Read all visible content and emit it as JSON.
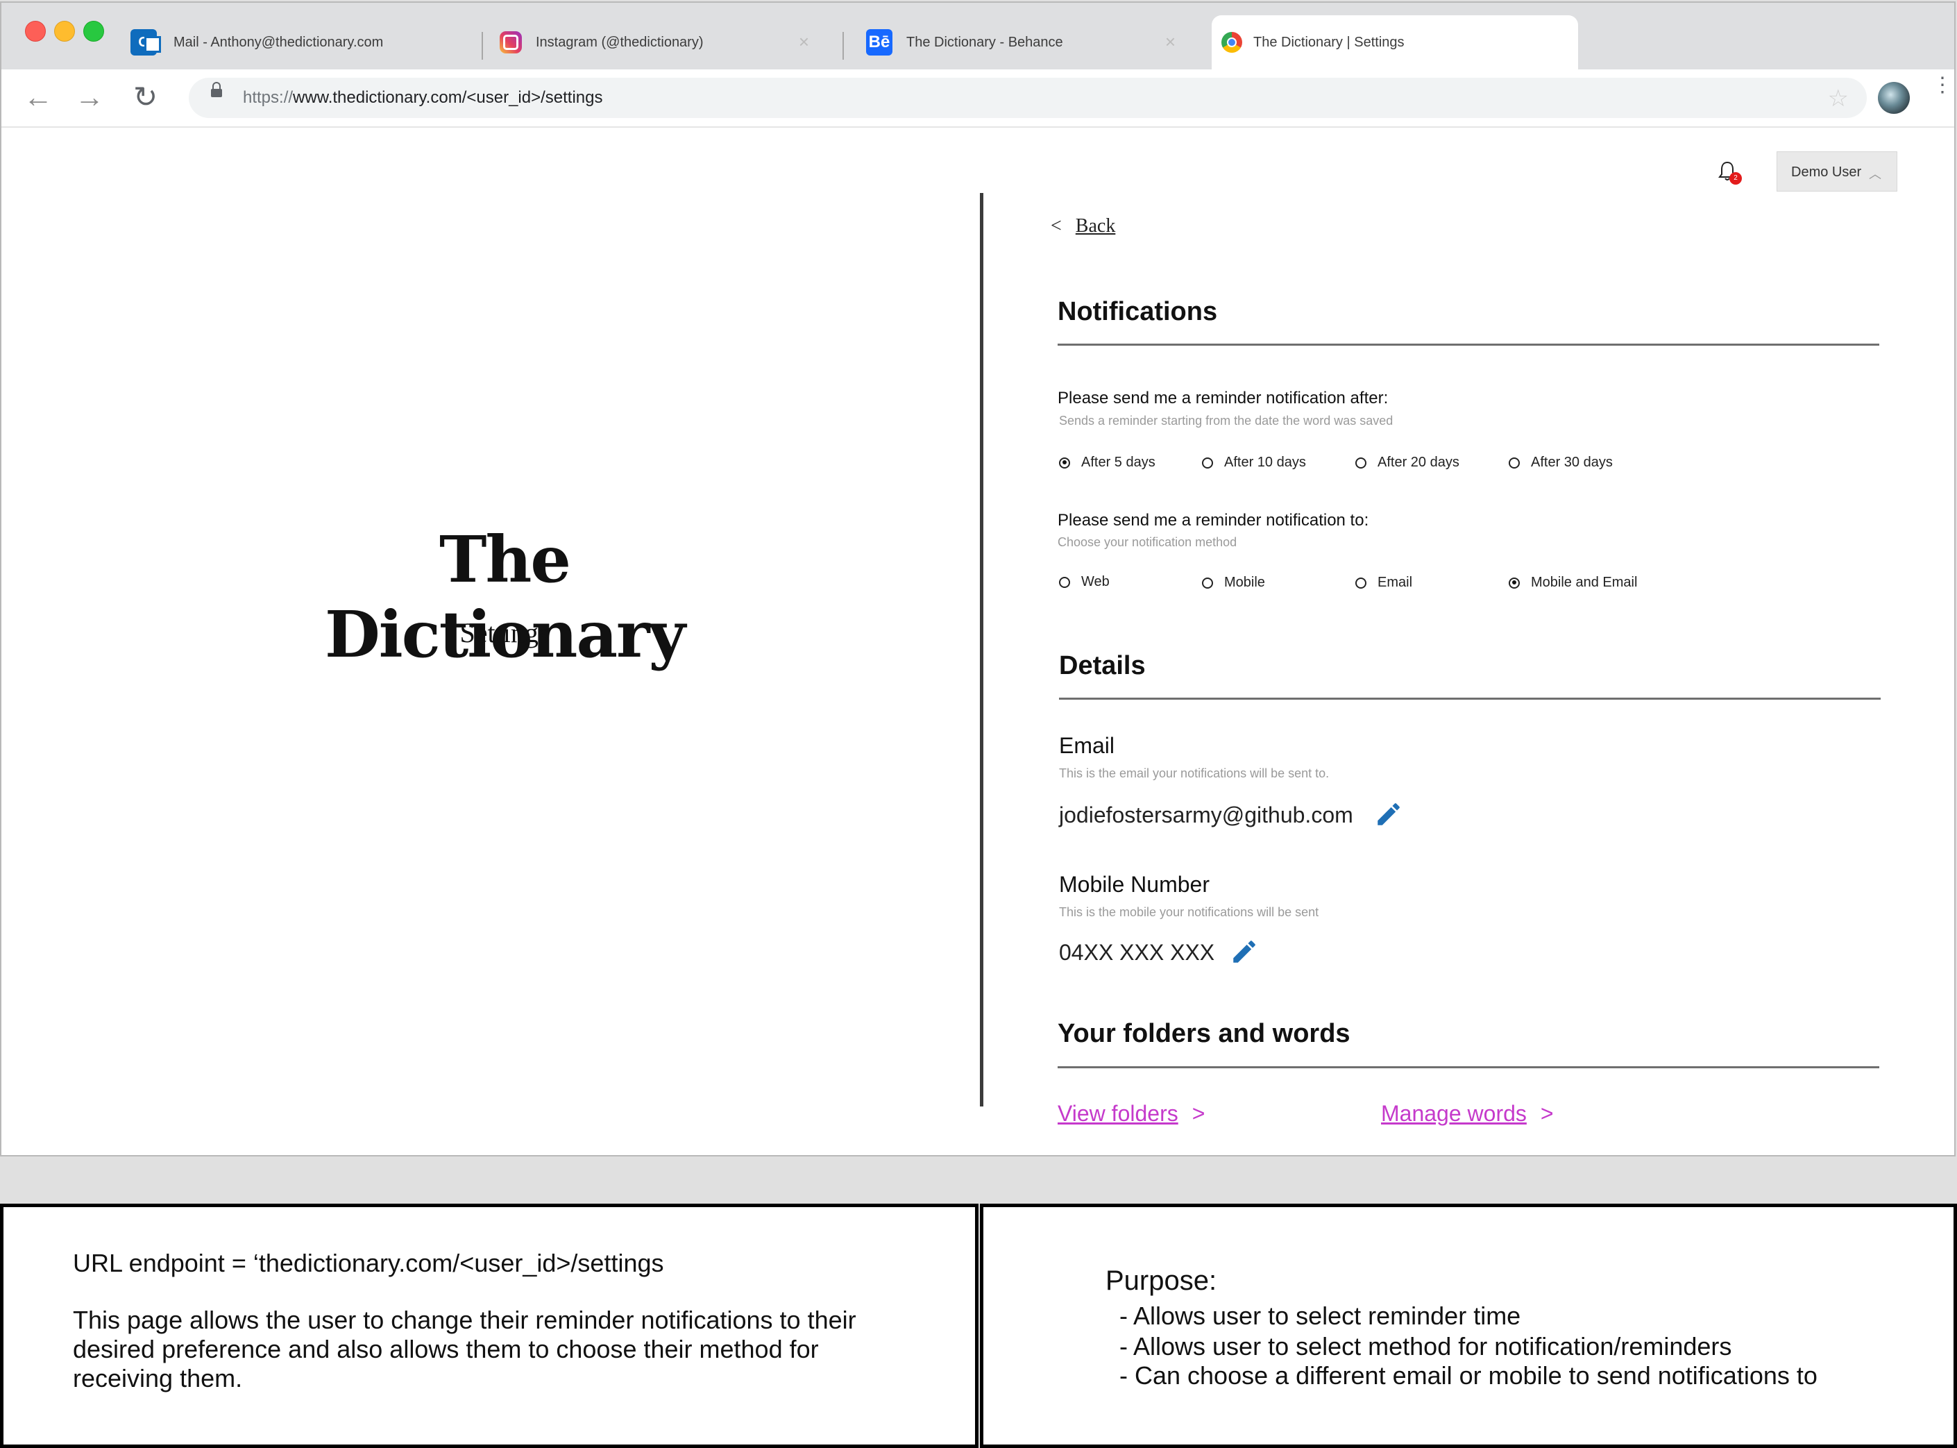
{
  "browser": {
    "tabs": [
      {
        "title": "Mail - Anthony@thedictionary.com",
        "icon": "outlook-icon"
      },
      {
        "title": "Instagram (@thedictionary)",
        "icon": "instagram-icon",
        "close": "×"
      },
      {
        "title": "The Dictionary - Behance",
        "icon": "behance-icon",
        "icon_text": "Bē",
        "close": "×"
      },
      {
        "title": "The Dictionary | Settings",
        "icon": "chrome-icon",
        "active": true
      }
    ],
    "address": {
      "scheme": "https://",
      "rest": "www.thedictionary.com/<user_id>/settings"
    },
    "nav": {
      "back": "←",
      "forward": "→",
      "reload": "↻",
      "star": "☆",
      "menu": "⋮"
    }
  },
  "header": {
    "notification_count": "2",
    "user_label": "Demo User",
    "user_chevron": "︿"
  },
  "brand": {
    "title": "The Dictionary",
    "subtitle": "Settings"
  },
  "back": {
    "chevron": "<",
    "label": "Back"
  },
  "notifications": {
    "heading": "Notifications",
    "after": {
      "question": "Please send me a reminder notification after:",
      "hint": "Sends a reminder starting from the date the word was saved",
      "options": [
        "After 5 days",
        "After 10 days",
        "After 20 days",
        "After 30 days"
      ],
      "selected": "After 5 days"
    },
    "to": {
      "question": "Please send me a reminder notification to:",
      "hint": "Choose your notification method",
      "options": [
        "Web",
        "Mobile",
        "Email",
        "Mobile and Email"
      ],
      "selected": "Mobile and Email"
    }
  },
  "details": {
    "heading": "Details",
    "email": {
      "label": "Email",
      "hint": "This is the email your notifications will be sent to.",
      "value": "jodiefostersarmy@github.com"
    },
    "mobile": {
      "label": "Mobile Number",
      "hint": "This is the mobile your notifications will be sent",
      "value": "04XX XXX XXX"
    }
  },
  "folders": {
    "heading": "Your folders and words",
    "links": [
      {
        "label": "View folders",
        "chevron": ">"
      },
      {
        "label": "Manage words",
        "chevron": ">"
      }
    ]
  },
  "annotations": {
    "left": {
      "endpoint": "URL endpoint = ‘thedictionary.com/<user_id>/settings",
      "description": "This page allows the user to change their reminder notifications to their desired preference and also allows them to choose their method for receiving them."
    },
    "right": {
      "title": "Purpose:",
      "items": [
        "- Allows user to select reminder time",
        "- Allows user to select method for notification/reminders",
        "- Can choose a different email or mobile to send notifications to"
      ]
    }
  },
  "colors": {
    "link": "#c53acb",
    "edit_icon": "#1f6fb5",
    "badge": "#e31c1c"
  }
}
